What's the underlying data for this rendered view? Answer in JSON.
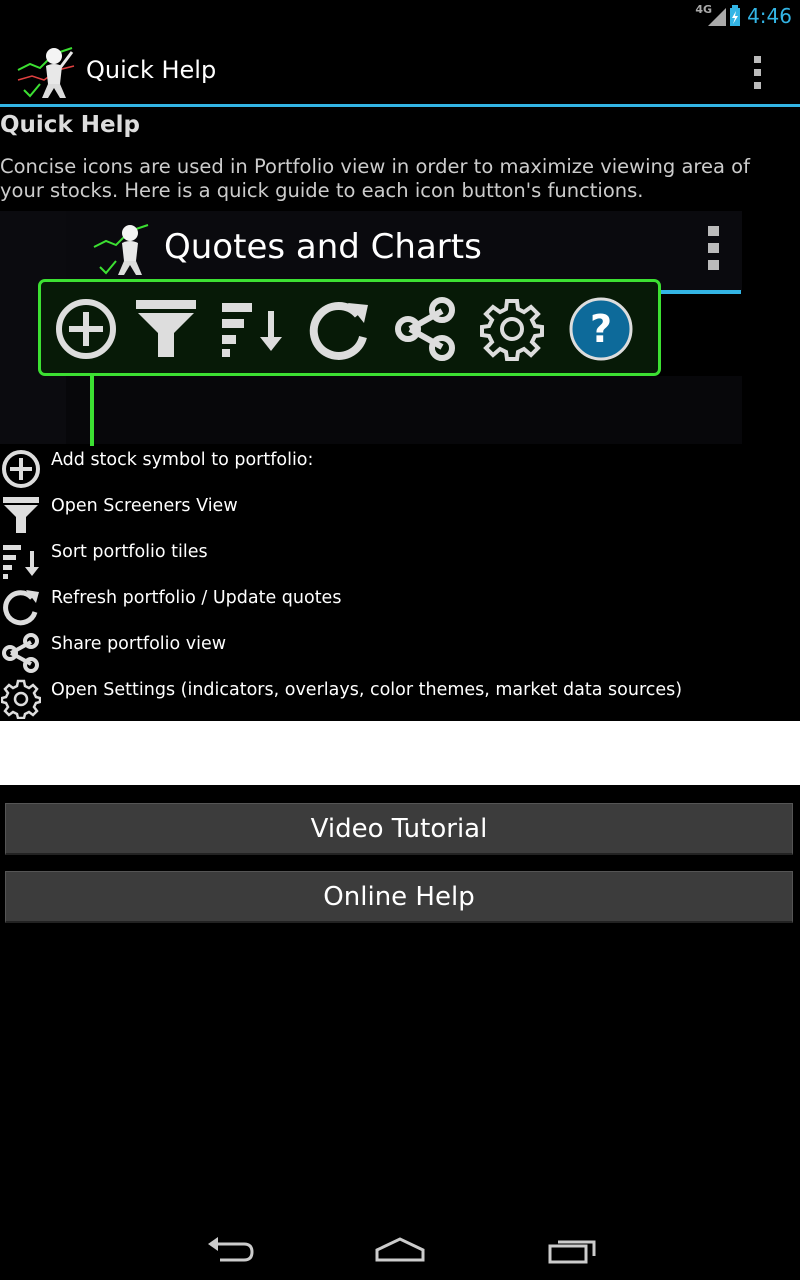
{
  "status": {
    "network": "4G",
    "time": "4:46"
  },
  "actionbar": {
    "title": "Quick Help"
  },
  "content": {
    "heading": "Quick Help",
    "intro": "Concise icons are used in Portfolio view in order to maximize viewing area of your stocks. Here is a quick guide to each icon button's functions."
  },
  "preview": {
    "title": "Quotes and Charts",
    "icons": [
      "add-circle-icon",
      "filter-icon",
      "sort-icon",
      "refresh-icon",
      "share-icon",
      "gear-icon",
      "help-icon"
    ]
  },
  "legend": [
    {
      "icon": "add-circle-icon",
      "label": "Add stock symbol to portfolio:"
    },
    {
      "icon": "filter-icon",
      "label": "Open Screeners View"
    },
    {
      "icon": "sort-icon",
      "label": "Sort portfolio tiles"
    },
    {
      "icon": "refresh-icon",
      "label": "Refresh portfolio / Update quotes"
    },
    {
      "icon": "share-icon",
      "label": "Share portfolio view"
    },
    {
      "icon": "gear-icon",
      "label": "Open Settings (indicators, overlays, color themes, market data sources)"
    }
  ],
  "buttons": {
    "video_tutorial": "Video Tutorial",
    "online_help": "Online Help"
  },
  "colors": {
    "accent": "#33b5e5",
    "highlight": "#3ce032",
    "button_bg": "#3c3c3c"
  }
}
